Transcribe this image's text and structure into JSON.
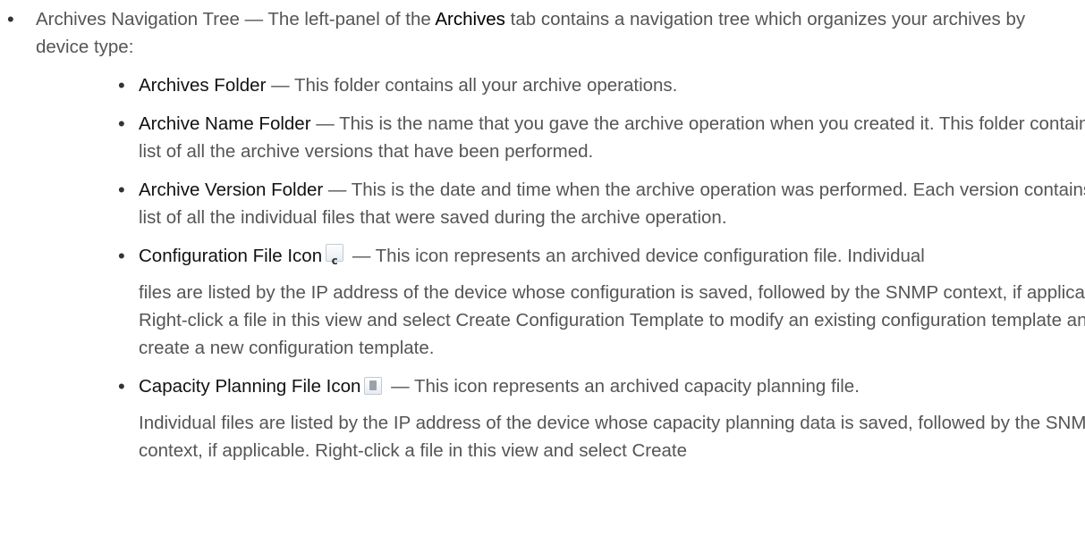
{
  "intro": {
    "term": "Archives Navigation Tree",
    "text_before": " — The left-panel of the ",
    "tab_name": "Archives",
    "text_after": " tab contains a navigation tree which organizes your archives by device type:"
  },
  "items": [
    {
      "term": "Archives Folder",
      "text": " — This folder contains all your archive operations."
    },
    {
      "term": "Archive Name Folder",
      "text": " — This is the name that you gave the archive operation when you created it. This folder contains a list of all the archive versions that have been performed."
    },
    {
      "term": "Archive Version Folder",
      "text": " — This is the date and time when the archive operation was performed. Each version contains a list of all the individual files that were saved during the archive operation."
    },
    {
      "term": "Configuration File Icon",
      "icon": "configuration-file-icon",
      "text": " — This icon represents an archived device configuration file. Individual",
      "para2": "files are listed by the IP address of the device whose configuration is saved, followed by the SNMP context, if applicable. Right-click a file in this view and select Create Configuration Template to modify an existing configuration template and create a new configuration template."
    },
    {
      "term": "Capacity Planning File Icon",
      "icon": "capacity-planning-file-icon",
      "text": " — This icon represents an archived capacity planning file.",
      "para2": "Individual files are listed by the IP address of the device whose capacity planning data is saved, followed by the SNMP context, if applicable. Right-click a file in this view and select Create"
    }
  ],
  "icon_glyphs": {
    "configuration": "c"
  }
}
